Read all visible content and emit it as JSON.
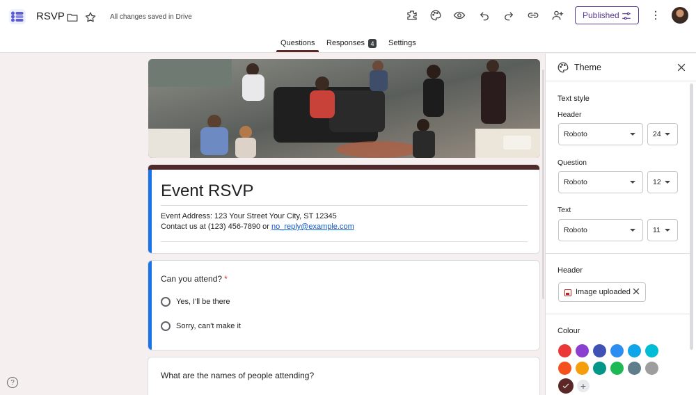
{
  "app": {
    "doc_title": "RSVP",
    "save_status": "All changes saved in Drive",
    "publish_label": "Published"
  },
  "tabs": [
    {
      "label": "Questions",
      "active": true
    },
    {
      "label": "Responses",
      "badge": "4"
    },
    {
      "label": "Settings"
    }
  ],
  "icons": {
    "toolbar": [
      "add-ons-icon",
      "palette-icon",
      "preview-eye-icon",
      "undo-icon",
      "redo-icon",
      "link-icon",
      "add-collaborator-icon",
      "more-vert-icon"
    ]
  },
  "form": {
    "title": "Event RSVP",
    "address": "Event Address: 123 Your Street Your City, ST 12345",
    "contact_prefix": "Contact us at (123) 456-7890 or ",
    "contact_email": "no_reply@example.com",
    "questions": [
      {
        "title": "Can you attend?",
        "required_mark": "*",
        "options": [
          "Yes,  I'll be there",
          "Sorry, can't make it"
        ]
      },
      {
        "title": "What are the names of people attending?"
      }
    ]
  },
  "theme_panel": {
    "title": "Theme",
    "text_style_title": "Text style",
    "header_label": "Header",
    "header_font": "Roboto",
    "header_size": "24",
    "question_label": "Question",
    "question_font": "Roboto",
    "question_size": "12",
    "text_label": "Text",
    "text_font": "Roboto",
    "text_size": "11",
    "header_section_title": "Header",
    "header_chip_label": "Image uploaded",
    "colour_title": "Colour",
    "colours_row1": [
      "#ea3838",
      "#8a3fd1",
      "#3f51b5",
      "#2b8ef0",
      "#0ea5e9",
      "#00bcd4"
    ],
    "colours_row2": [
      "#f4511e",
      "#f59e0b",
      "#009688",
      "#1db954",
      "#607d8b",
      "#9e9e9e"
    ],
    "selected_colour": "#5b2727"
  }
}
